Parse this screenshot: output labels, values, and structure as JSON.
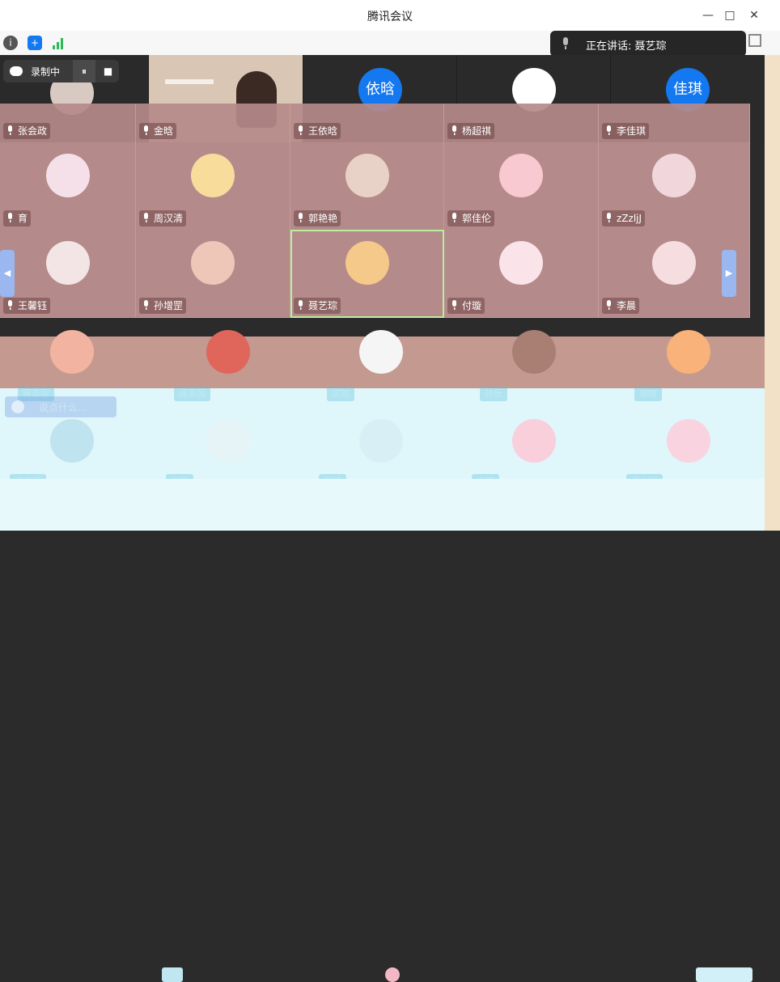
{
  "window": {
    "title": "腾讯会议",
    "minimize": "—",
    "maximize": "□",
    "close": "✕"
  },
  "toolbar": {
    "info_icon": "info-icon",
    "shield_icon": "shield-icon",
    "signal_icon": "signal-icon"
  },
  "speaker": {
    "label": "正在讲话: 聂艺琮"
  },
  "recording": {
    "label": "录制中",
    "pause": "⏸",
    "stop": "■"
  },
  "top_row": [
    {
      "kind": "photo"
    },
    {
      "kind": "video"
    },
    {
      "kind": "initials",
      "text": "依晗"
    },
    {
      "kind": "blank"
    },
    {
      "kind": "initials",
      "text": "佳琪"
    }
  ],
  "participants": [
    {
      "name": "张会政"
    },
    {
      "name": "金晗"
    },
    {
      "name": "王依晗"
    },
    {
      "name": "杨超祺"
    },
    {
      "name": "李佳琪"
    },
    {
      "name": "育"
    },
    {
      "name": "周汉清"
    },
    {
      "name": "郭艳艳"
    },
    {
      "name": "郭佳伦"
    },
    {
      "name": "zZzljJ"
    },
    {
      "name": "王馨钰"
    },
    {
      "name": "孙增罡"
    },
    {
      "name": "聂艺琮"
    },
    {
      "name": "付璇"
    },
    {
      "name": "李晨"
    }
  ],
  "faint_row1": [
    "蒋亚菲",
    "薛英国",
    "梁锐",
    "孙乐",
    "谢婷"
  ],
  "faint_row2": [
    "宋佳琪",
    "肖茹",
    "张琦",
    "卢梦",
    "王小丽"
  ],
  "chat": {
    "placeholder": "说点什么..."
  },
  "colors": {
    "tile_bg": "#b58a8a",
    "accent_blue": "#1478f0",
    "selected_outline": "#b8f0a0"
  }
}
